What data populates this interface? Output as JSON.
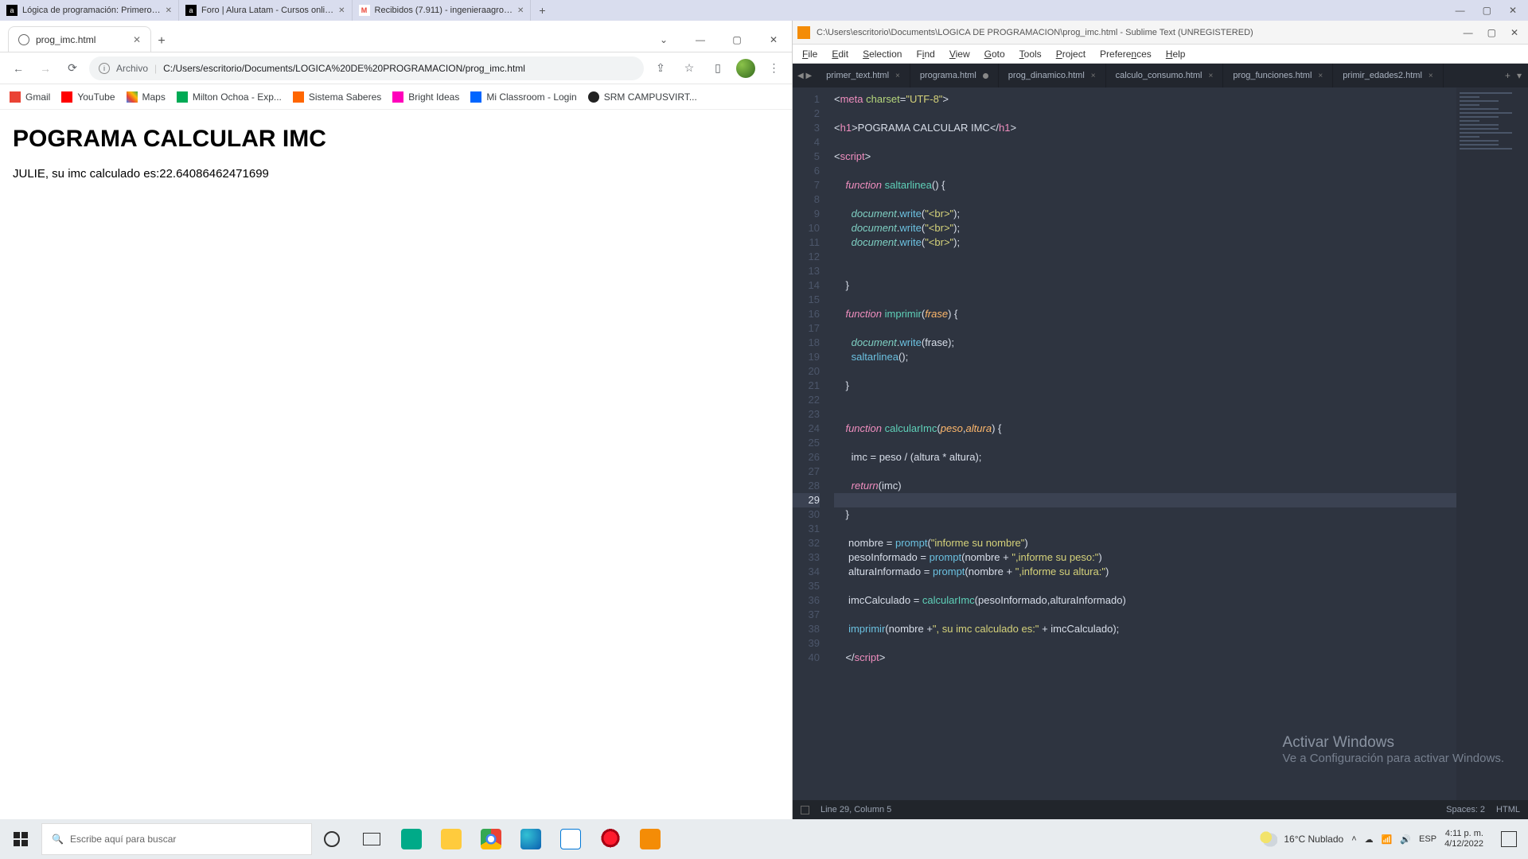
{
  "topTabs": [
    {
      "icon": "a",
      "label": "Lógica de programación: Primero…"
    },
    {
      "icon": "a",
      "label": "Foro | Alura Latam - Cursos onli…"
    },
    {
      "icon": "gm",
      "label": "Recibidos (7.911) - ingenieraagro…"
    }
  ],
  "chrome": {
    "tabTitle": "prog_imc.html",
    "omni": {
      "prefix": "Archivo",
      "url": "C:/Users/escritorio/Documents/LOGICA%20DE%20PROGRAMACION/prog_imc.html"
    },
    "bookmarks": [
      "Gmail",
      "YouTube",
      "Maps",
      "Milton Ochoa - Exp...",
      "Sistema Saberes",
      "Bright Ideas",
      "Mi Classroom - Login",
      "SRM CAMPUSVIRT..."
    ],
    "page": {
      "h1": "POGRAMA CALCULAR IMC",
      "p": "JULIE, su imc calculado es:22.64086462471699"
    }
  },
  "sublime": {
    "title": "C:\\Users\\escritorio\\Documents\\LOGICA DE PROGRAMACION\\prog_imc.html - Sublime Text (UNREGISTERED)",
    "menu": [
      "File",
      "Edit",
      "Selection",
      "Find",
      "View",
      "Goto",
      "Tools",
      "Project",
      "Preferences",
      "Help"
    ],
    "tabs": [
      {
        "label": "primer_text.html",
        "active": false,
        "dirty": false
      },
      {
        "label": "programa.html",
        "active": false,
        "dirty": true
      },
      {
        "label": "prog_dinamico.html",
        "active": false,
        "dirty": false
      },
      {
        "label": "calculo_consumo.html",
        "active": false,
        "dirty": false
      },
      {
        "label": "prog_funciones.html",
        "active": false,
        "dirty": false
      },
      {
        "label": "primir_edades2.html",
        "active": false,
        "dirty": false
      }
    ],
    "currentLine": 29,
    "status": {
      "pos": "Line 29, Column 5",
      "spaces": "Spaces: 2",
      "lang": "HTML"
    },
    "watermark": {
      "t1": "Activar Windows",
      "t2": "Ve a Configuración para activar Windows."
    }
  },
  "taskbar": {
    "searchPlaceholder": "Escribe aquí para buscar",
    "weather": "16°C  Nublado",
    "ime": "ESP",
    "time": "4:11 p. m.",
    "date": "4/12/2022"
  }
}
